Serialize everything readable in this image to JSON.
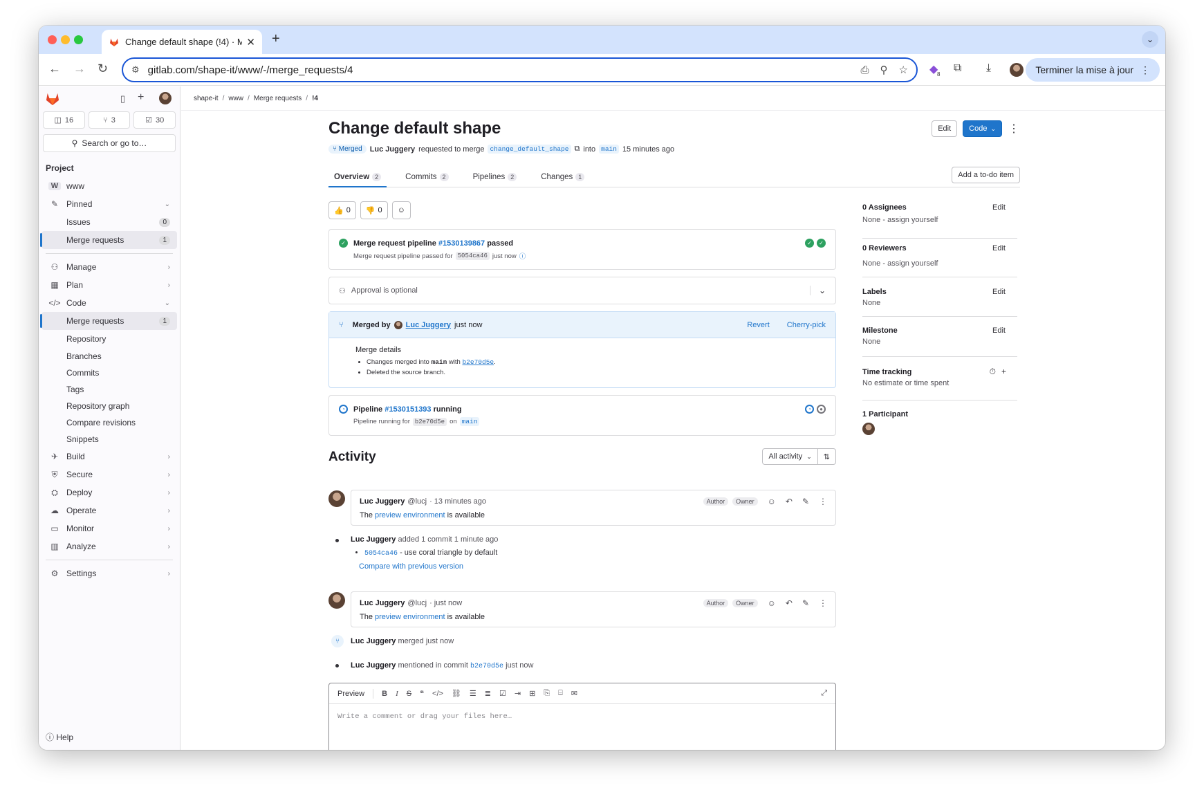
{
  "browser": {
    "tab_title": "Change default shape (!4) · M",
    "url": "gitlab.com/shape-it/www/-/merge_requests/4",
    "update_button": "Terminer la mise à jour",
    "extension_badge": "8"
  },
  "sidebar": {
    "counts": [
      {
        "icon": "issues-icon",
        "value": "16"
      },
      {
        "icon": "merge-request-icon",
        "value": "3"
      },
      {
        "icon": "todo-icon",
        "value": "30"
      }
    ],
    "search_label": "Search or go to…",
    "section": "Project",
    "project_initial": "W",
    "project_name": "www",
    "pinned": "Pinned",
    "pinned_items": [
      {
        "label": "Issues",
        "badge": "0"
      },
      {
        "label": "Merge requests",
        "badge": "1"
      }
    ],
    "manage": "Manage",
    "plan": "Plan",
    "code": "Code",
    "code_items": [
      {
        "label": "Merge requests",
        "badge": "1"
      },
      {
        "label": "Repository"
      },
      {
        "label": "Branches"
      },
      {
        "label": "Commits"
      },
      {
        "label": "Tags"
      },
      {
        "label": "Repository graph"
      },
      {
        "label": "Compare revisions"
      },
      {
        "label": "Snippets"
      }
    ],
    "build": "Build",
    "secure": "Secure",
    "deploy": "Deploy",
    "operate": "Operate",
    "monitor": "Monitor",
    "analyze": "Analyze",
    "settings": "Settings",
    "help": "Help"
  },
  "breadcrumb": [
    "shape-it",
    "www",
    "Merge requests",
    "!4"
  ],
  "mr": {
    "title": "Change default shape",
    "edit": "Edit",
    "code": "Code",
    "status": "Merged",
    "author": "Luc Juggery",
    "requested_text": "requested to merge",
    "source_branch": "change_default_shape",
    "into": "into",
    "target_branch": "main",
    "time": "15 minutes ago"
  },
  "tabs": [
    {
      "label": "Overview",
      "count": "2"
    },
    {
      "label": "Commits",
      "count": "2"
    },
    {
      "label": "Pipelines",
      "count": "2"
    },
    {
      "label": "Changes",
      "count": "1"
    }
  ],
  "todo_button": "Add a to-do item",
  "reactions": {
    "thumbs_up": "0",
    "thumbs_down": "0"
  },
  "pipeline1": {
    "title_prefix": "Merge request pipeline",
    "id": "#1530139867",
    "status": "passed",
    "sub_prefix": "Merge request pipeline passed for",
    "commit": "5054ca46",
    "sub_time": "just now"
  },
  "approval": "Approval is optional",
  "merged_widget": {
    "prefix": "Merged by",
    "user": "Luc Juggery",
    "time": "just now",
    "revert": "Revert",
    "cherry_pick": "Cherry-pick",
    "details_title": "Merge details",
    "line1_prefix": "Changes merged into",
    "line1_branch": "main",
    "line1_with": "with",
    "line1_commit": "b2e70d5e",
    "line2": "Deleted the source branch."
  },
  "pipeline2": {
    "title_prefix": "Pipeline",
    "id": "#1530151393",
    "status": "running",
    "sub_prefix": "Pipeline running for",
    "commit": "b2e70d5e",
    "on": "on",
    "branch": "main"
  },
  "activity": {
    "title": "Activity",
    "filter": "All activity",
    "notes": [
      {
        "author": "Luc Juggery",
        "handle": "@lucj",
        "time": "· 13 minutes ago",
        "role1": "Author",
        "role2": "Owner",
        "body_pre": "The",
        "body_link": "preview environment",
        "body_post": "is available"
      },
      {
        "author": "Luc Juggery",
        "handle": "@lucj",
        "time": "· just now",
        "role1": "Author",
        "role2": "Owner",
        "body_pre": "The",
        "body_link": "preview environment",
        "body_post": "is available"
      }
    ],
    "commit_event": {
      "author": "Luc Juggery",
      "text": "added 1 commit 1 minute ago",
      "commit": "5054ca46",
      "commit_msg": "- use coral triangle by default",
      "compare": "Compare with previous version"
    },
    "merged_event": {
      "author": "Luc Juggery",
      "text": "merged just now"
    },
    "mention_event": {
      "author": "Luc Juggery",
      "text": "mentioned in commit",
      "commit": "b2e70d5e",
      "time": "just now"
    }
  },
  "editor": {
    "preview": "Preview",
    "placeholder": "Write a comment or drag your files here…"
  },
  "right": {
    "assignees": "0 Assignees",
    "assignees_val": "None - assign yourself",
    "reviewers": "0 Reviewers",
    "reviewers_val": "None - assign yourself",
    "labels": "Labels",
    "labels_val": "None",
    "milestone": "Milestone",
    "milestone_val": "None",
    "time_tracking": "Time tracking",
    "time_val": "No estimate or time spent",
    "participants": "1 Participant",
    "edit": "Edit"
  },
  "colors": {
    "accent": "#1f75cb",
    "success": "#2da160",
    "chrome_tab": "#d3e3fd"
  }
}
